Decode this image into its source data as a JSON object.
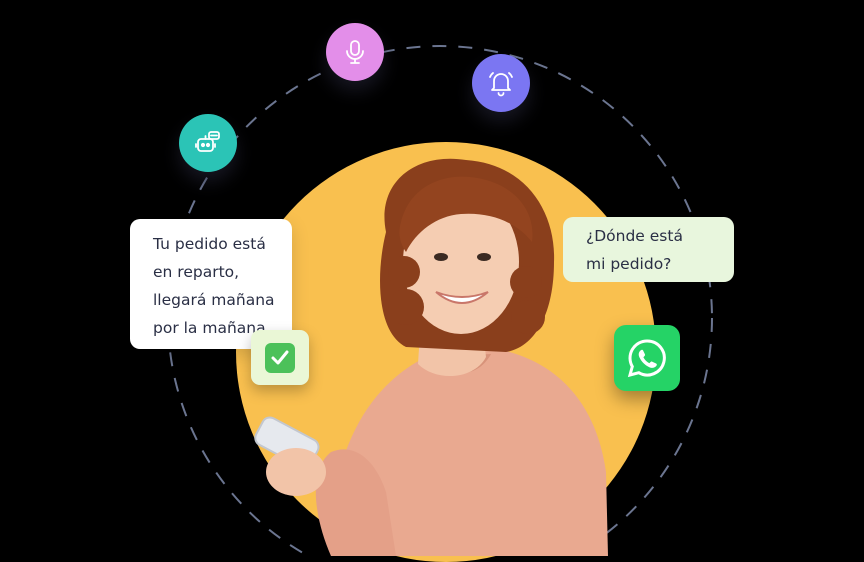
{
  "illustration": {
    "icons": [
      {
        "name": "chatbot-icon",
        "color": "#2bc4b6"
      },
      {
        "name": "microphone-icon",
        "color": "#e38ee9"
      },
      {
        "name": "bell-icon",
        "color": "#7b76f2"
      }
    ],
    "reply_bubble": {
      "lines": [
        "Tu pedido está",
        "en reparto,",
        "llegará mañana",
        "por la mañana"
      ]
    },
    "question_bubble": {
      "lines": [
        "¿Dónde está",
        "mi pedido?"
      ]
    },
    "check_badge_icon": "check-mark-icon",
    "whatsapp_icon": "whatsapp-icon",
    "colors": {
      "background": "#000000",
      "disc": "#f9c04f",
      "reply_bubble": "#ffffff",
      "question_bubble": "#e8f6dd",
      "check": "#4cc15a",
      "whatsapp": "#25d366"
    }
  }
}
